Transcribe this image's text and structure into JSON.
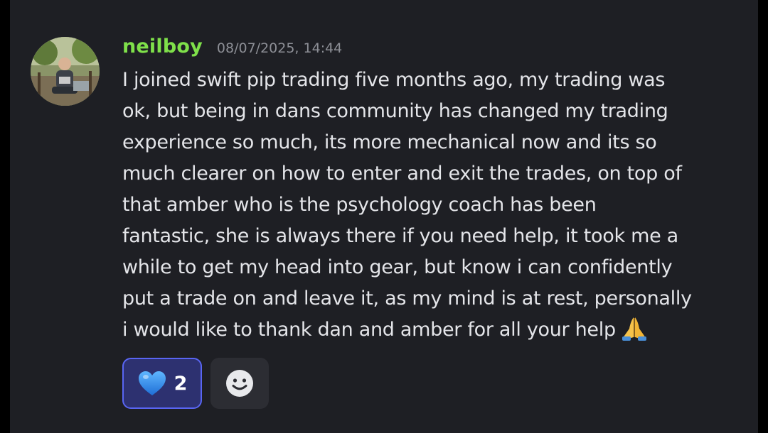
{
  "message": {
    "author": {
      "username": "neilboy",
      "name_color": "#7fe04a",
      "avatar_icon": "user-avatar-photo"
    },
    "timestamp": "08/07/2025, 14:44",
    "lines": [
      "I joined swift pip trading five months ago, my trading was",
      "ok, but being in dans community has changed my trading",
      "experience so much, its more mechanical now and its so",
      "much clearer on how to enter and exit the trades, on top of",
      "that amber who is the  psychology coach has been",
      "fantastic, she is always there if you need help, it took me a",
      "while to get my head into gear, but know i can confidently",
      "put a trade on and leave it, as my mind is at rest, personally",
      "i would like to thank dan and amber for all your help"
    ],
    "trailing_emoji": "folded-hands-emoji"
  },
  "reactions": [
    {
      "emoji": "blue-heart-emoji",
      "count": "2",
      "selected": true,
      "accent": "#5965f2"
    }
  ],
  "add_reaction": {
    "icon": "smiley-face-icon"
  },
  "colors": {
    "background": "#1e1f24",
    "text": "#e4e5e9",
    "timestamp": "#8d8f96"
  }
}
